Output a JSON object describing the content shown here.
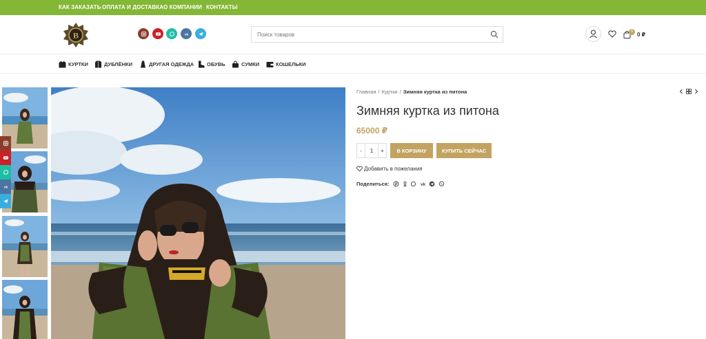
{
  "topbar": {
    "links": [
      "КАК ЗАКАЗАТЬ",
      "ОПЛАТА И ДОСТАВКА",
      "О КОМПАНИИ",
      "КОНТАКТЫ"
    ]
  },
  "header": {
    "logo_letter": "B",
    "social_icons": [
      "instagram-icon",
      "youtube-icon",
      "whatsapp-icon",
      "vk-icon",
      "telegram-icon"
    ],
    "search_placeholder": "Поиск товаров",
    "cart_count": "0",
    "cart_total": "0 ₽"
  },
  "nav": {
    "items": [
      "КУРТКИ",
      "ДУБЛЁНКИ",
      "ДРУГАЯ ОДЕЖДА",
      "ОБУВЬ",
      "СУМКИ",
      "КОШЕЛЬКИ"
    ]
  },
  "product": {
    "breadcrumb": [
      "Главная",
      "Куртки",
      "Зимняя куртка из питона"
    ],
    "title": "Зимняя куртка из питона",
    "price": "65000 ₽",
    "qty_minus": "-",
    "qty_value": "1",
    "qty_plus": "+",
    "add_to_cart": "В КОРЗИНУ",
    "buy_now": "КУПИТЬ СЕЙЧАС",
    "wishlist": "Добавить в пожелания",
    "share_label": "Поделиться:"
  },
  "colors": {
    "accent_green": "#83b735",
    "brand_gold": "#c2a362",
    "instagram": "#8a3d2c",
    "youtube": "#cb2027",
    "whatsapp": "#1ebea5",
    "vk": "#4c75a3",
    "telegram": "#37aee2"
  }
}
